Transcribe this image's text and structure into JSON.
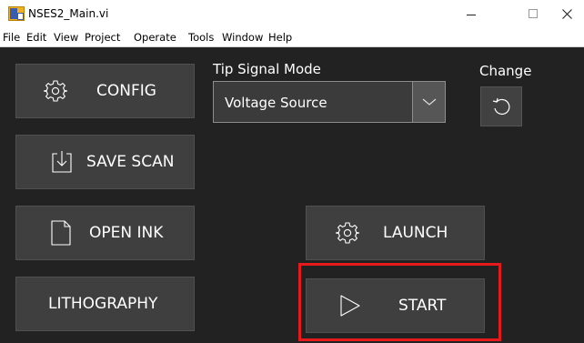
{
  "window": {
    "title": "NSES2_Main.vi",
    "controls": {
      "minimize": "–",
      "close": "✕"
    }
  },
  "menu": [
    "File",
    "Edit",
    "View",
    "Project",
    "Operate",
    "Tools",
    "Window",
    "Help"
  ],
  "buttons": {
    "config": "CONFIG",
    "save_scan": "SAVE SCAN",
    "open_ink": "OPEN INK",
    "lithography": "LITHOGRAPHY",
    "launch": "LAUNCH",
    "start": "START"
  },
  "tip_signal_mode": {
    "label": "Tip Signal Mode",
    "selected": "Voltage Source"
  },
  "change": {
    "label": "Change"
  },
  "colors": {
    "panel_background": "#222222",
    "button_background": "#3f3f3f",
    "highlight": "#e51b1b"
  },
  "icons": {
    "config": "gear-icon",
    "save_scan": "download-icon",
    "open_ink": "document-icon",
    "launch": "gear-icon",
    "start": "play-icon",
    "change": "undo-icon",
    "dropdown": "chevron-down-icon"
  }
}
